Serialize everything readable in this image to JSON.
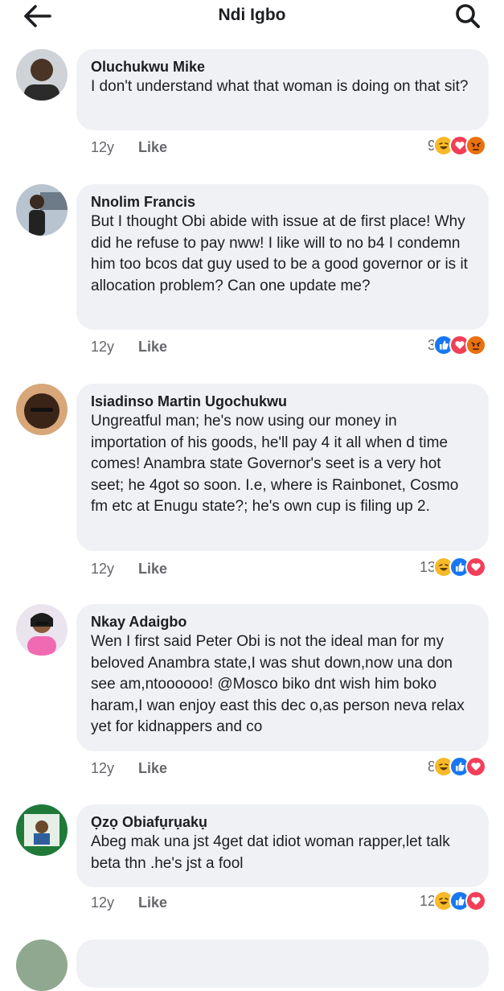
{
  "header": {
    "title": "Ndi Igbo"
  },
  "like_label": "Like",
  "comments": [
    {
      "author": "Oluchukwu Mike",
      "text": "I don't understand what that woman is doing on that sit?",
      "time": "12y",
      "reaction_count": "9",
      "reactions": [
        "haha-icon",
        "love-icon",
        "angry-icon"
      ]
    },
    {
      "author": "Nnolim Francis",
      "text": "But I thought Obi abide with issue at de first place! Why did he refuse to pay nww! I like will to no b4 I condemn him too bcos dat guy used to be a good governor or is it allocation problem? Can one update me?",
      "time": "12y",
      "reaction_count": "3",
      "reactions": [
        "like-icon",
        "love-icon",
        "angry-icon"
      ]
    },
    {
      "author": "Isiadinso Martin Ugochukwu",
      "text": "Ungreatful man; he's now using our money in importation of his goods, he'll pay 4 it all when d time comes! Anambra state Governor's seet is a very hot seet; he 4got so soon. I.e, where is Rainbonet, Cosmo fm etc at Enugu state?; he's own cup is filing up 2.",
      "time": "12y",
      "reaction_count": "13",
      "reactions": [
        "haha-icon",
        "like-icon",
        "love-icon"
      ]
    },
    {
      "author": "Nkay Adaigbo",
      "text": "Wen I first said Peter Obi is not the ideal man for my beloved Anambra state,I was shut down,now una don see am,ntoooooo! @Mosco biko dnt wish him boko haram,I wan enjoy east this dec o,as person neva relax yet for kidnappers and co",
      "time": "12y",
      "reaction_count": "8",
      "reactions": [
        "haha-icon",
        "like-icon",
        "love-icon"
      ]
    },
    {
      "author": "Ọzọ Obiafụrụakụ",
      "text": "Abeg mak una jst 4get dat idiot woman rapper,let talk beta thn .he's jst a fool",
      "time": "12y",
      "reaction_count": "12",
      "reactions": [
        "haha-icon",
        "like-icon",
        "love-icon"
      ]
    }
  ]
}
